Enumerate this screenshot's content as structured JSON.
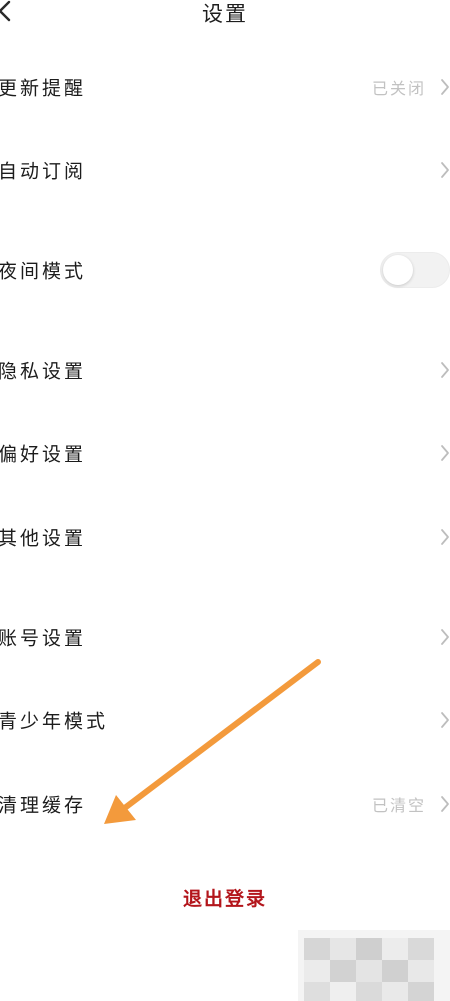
{
  "header": {
    "title": "设置",
    "back_icon": "chevron-left-icon"
  },
  "settings": [
    {
      "label": "更新提醒",
      "value": "已关闭",
      "control": "chevron"
    },
    {
      "label": "自动订阅",
      "value": "",
      "control": "chevron"
    },
    {
      "label": "夜间模式",
      "value": "",
      "control": "toggle",
      "toggle_on": false
    },
    {
      "label": "隐私设置",
      "value": "",
      "control": "chevron"
    },
    {
      "label": "偏好设置",
      "value": "",
      "control": "chevron"
    },
    {
      "label": "其他设置",
      "value": "",
      "control": "chevron"
    },
    {
      "label": "账号设置",
      "value": "",
      "control": "chevron"
    },
    {
      "label": "青少年模式",
      "value": "",
      "control": "chevron"
    },
    {
      "label": "清理缓存",
      "value": "已清空",
      "control": "chevron"
    }
  ],
  "logout_label": "退出登录",
  "colors": {
    "text": "#1c1c1c",
    "muted_value": "#c2c2c2",
    "chevron": "#bdbdbd",
    "logout": "#b3151b",
    "annotation_arrow": "#f39a3c",
    "toggle_track": "#f2f2f2"
  }
}
